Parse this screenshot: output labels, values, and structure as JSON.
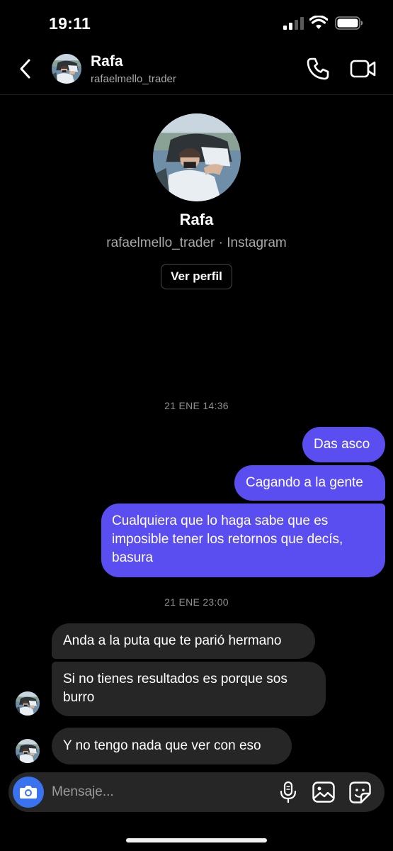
{
  "status_bar": {
    "time": "19:11"
  },
  "header": {
    "name": "Rafa",
    "username": "rafaelmello_trader",
    "avatar_icon": "person-driving-car-photo"
  },
  "profile": {
    "name": "Rafa",
    "subtitle": "rafaelmello_trader · Instagram",
    "view_profile_label": "Ver perfil"
  },
  "conversation": [
    {
      "timestamp": "21 ENE 14:36",
      "messages": [
        {
          "direction": "outgoing",
          "lines": [
            "Das asco"
          ]
        },
        {
          "direction": "outgoing",
          "lines": [
            "Cagando a la gente"
          ]
        },
        {
          "direction": "outgoing",
          "lines": [
            "Cualquiera que lo haga sabe que es",
            "imposible tener los retornos que decís,",
            "basura"
          ]
        }
      ]
    },
    {
      "timestamp": "21 ENE 23:00",
      "messages": [
        {
          "direction": "incoming",
          "lines": [
            "Anda a la puta que te parió hermano"
          ]
        },
        {
          "direction": "incoming",
          "lines": [
            "Si no tienes resultados es porque sos",
            "burro"
          ]
        },
        {
          "direction": "incoming",
          "lines": [
            "Y no tengo nada que ver con eso"
          ]
        }
      ]
    }
  ],
  "composer": {
    "placeholder": "Mensaje...",
    "icons": [
      "camera-icon",
      "microphone-icon",
      "gallery-icon",
      "sticker-icon"
    ]
  },
  "colors": {
    "outgoing_bubble": "#5b4ef0",
    "incoming_bubble": "#262626",
    "camera_button": "#3a73f0",
    "background": "#000000"
  }
}
